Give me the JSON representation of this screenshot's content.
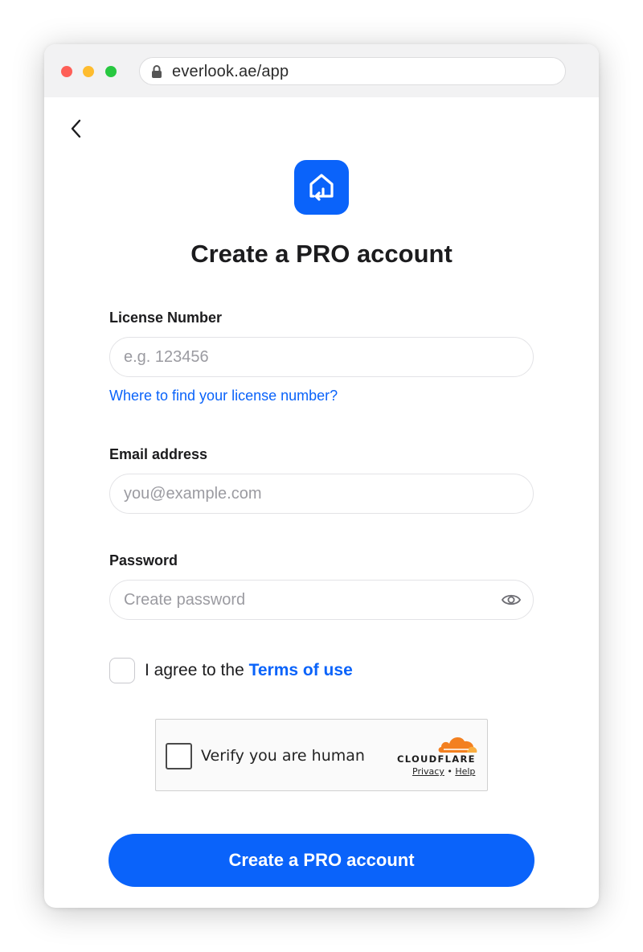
{
  "browser": {
    "url": "everlook.ae/app"
  },
  "form": {
    "title": "Create a PRO account",
    "license": {
      "label": "License Number",
      "placeholder": "e.g. 123456",
      "value": "",
      "help_link": "Where to find your license number?"
    },
    "email": {
      "label": "Email address",
      "placeholder": "you@example.com",
      "value": ""
    },
    "password": {
      "label": "Password",
      "placeholder": "Create password",
      "value": ""
    },
    "terms": {
      "prefix": "I agree to the ",
      "link": "Terms of use",
      "checked": false
    },
    "captcha": {
      "label": "Verify you are human",
      "brand": "CLOUDFLARE",
      "privacy": "Privacy",
      "separator": " • ",
      "help": "Help",
      "checked": false
    },
    "submit_label": "Create a PRO account"
  },
  "icons": {
    "back": "chevron-left-icon",
    "lock": "lock-icon",
    "logo": "house-arrow-icon",
    "eye": "eye-icon",
    "cloudflare": "cloudflare-cloud-icon"
  },
  "colors": {
    "accent": "#0a63fa",
    "cloudflare_orange": "#f38020",
    "window_chrome": "#f2f2f3"
  }
}
